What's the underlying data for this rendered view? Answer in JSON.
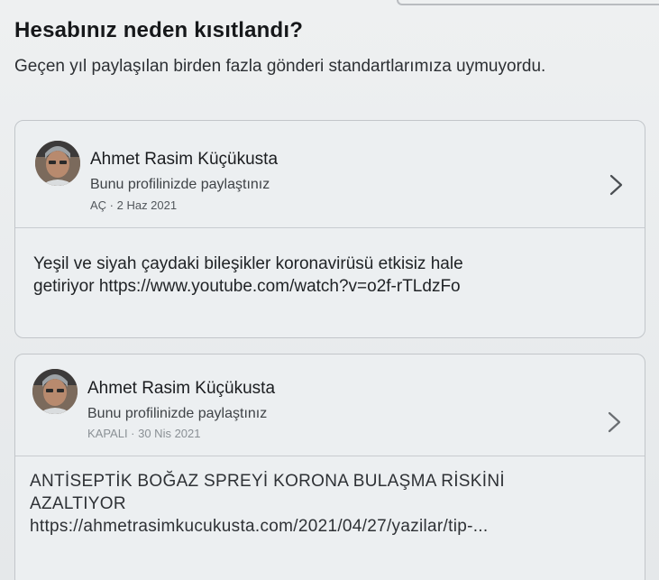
{
  "header": {
    "title": "Hesabınız neden kısıtlandı?",
    "subtitle": "Geçen yıl paylaşılan birden fazla gönderi standartlarımıza uymuyordu."
  },
  "posts": [
    {
      "author": "Ahmet Rasim Küçükusta",
      "shared_label": "Bunu profilinizde paylaştınız",
      "meta": "AÇ · 2 Haz 2021",
      "text_lines": [
        "Yeşil ve siyah çaydaki bileşikler koronavirüsü etkisiz hale",
        "getiriyor https://www.youtube.com/watch?v=o2f-rTLdzFo"
      ]
    },
    {
      "author": "Ahmet Rasim Küçükusta",
      "shared_label": "Bunu profilinizde paylaştınız",
      "meta": "KAPALI · 30 Nis 2021",
      "text_lines": [
        "ANTİSEPTİK BOĞAZ SPREYİ KORONA BULAŞMA RİSKİNİ",
        "AZALTIYOR",
        "https://ahmetrasimkucukusta.com/2021/04/27/yazilar/tip-..."
      ]
    }
  ],
  "icons": {
    "chevron": "chevron-right-icon",
    "avatar": "profile-photo"
  }
}
